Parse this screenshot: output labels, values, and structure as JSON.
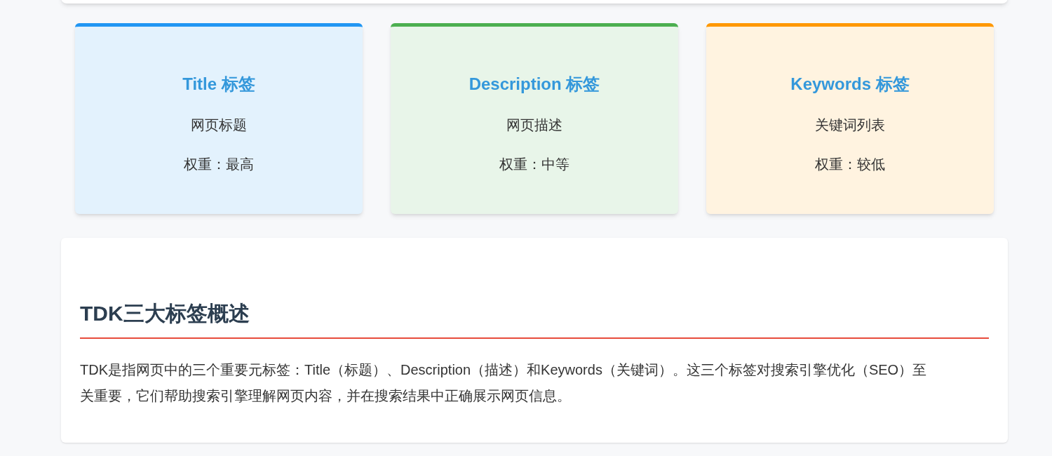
{
  "tag_cards": [
    {
      "kind": "title",
      "title": "Title 标签",
      "description": "网页标题",
      "weight": "权重：最高",
      "color": "#2196f3"
    },
    {
      "kind": "description",
      "title": "Description 标签",
      "description": "网页描述",
      "weight": "权重：中等",
      "color": "#4caf50"
    },
    {
      "kind": "keywords",
      "title": "Keywords 标签",
      "description": "关键词列表",
      "weight": "权重：较低",
      "color": "#ff9800"
    }
  ],
  "overview": {
    "heading": "TDK三大标签概述",
    "paragraph": "TDK是指网页中的三个重要元标签：Title（标题）、Description（描述）和Keywords（关键词）。这三个标签对搜索引擎优化（SEO）至关重要，它们帮助搜索引擎理解网页内容，并在搜索结果中正确展示网页信息。"
  }
}
